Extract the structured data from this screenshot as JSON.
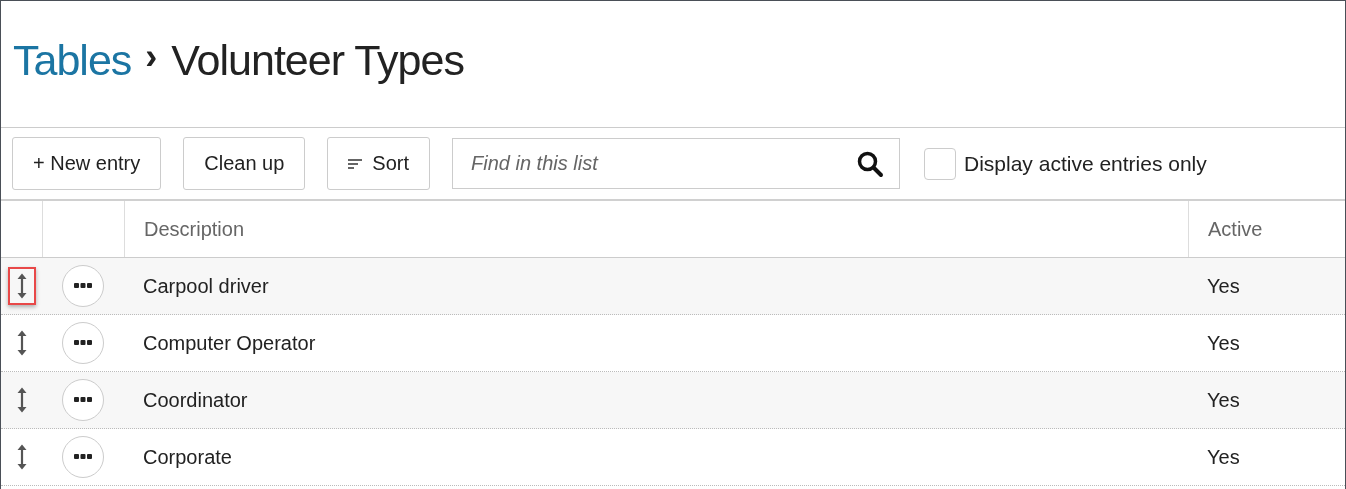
{
  "breadcrumb": {
    "parent": "Tables",
    "separator": "›",
    "current": "Volunteer Types"
  },
  "toolbar": {
    "buttons": [
      {
        "kind": "new",
        "label": "+ New entry"
      },
      {
        "kind": "plain",
        "label": "Clean up"
      },
      {
        "kind": "sort",
        "label": "Sort"
      }
    ],
    "search": {
      "placeholder": "Find in this list"
    },
    "filter": {
      "label": "Display active entries only",
      "checked": false
    }
  },
  "table": {
    "columns": [
      "Description",
      "Active"
    ],
    "rows": [
      {
        "description": "Carpool driver",
        "active": "Yes",
        "highlighted": true
      },
      {
        "description": "Computer Operator",
        "active": "Yes",
        "highlighted": false
      },
      {
        "description": "Coordinator",
        "active": "Yes",
        "highlighted": false
      },
      {
        "description": "Corporate",
        "active": "Yes",
        "highlighted": false
      }
    ]
  }
}
